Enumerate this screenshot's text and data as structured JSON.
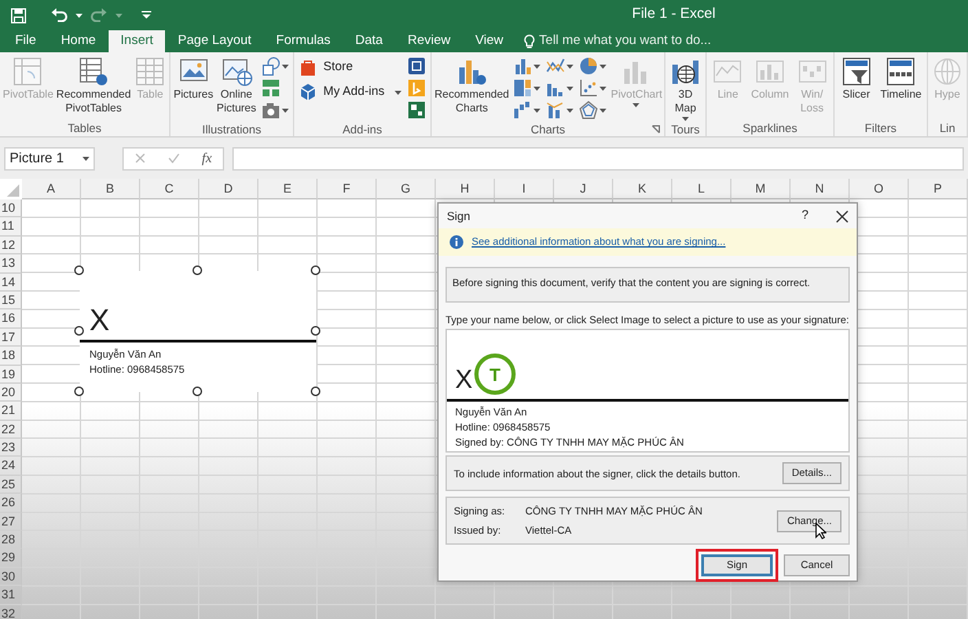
{
  "window": {
    "title": "File 1 - Excel"
  },
  "ribbon_tabs": [
    {
      "label": "File",
      "selected": false
    },
    {
      "label": "Home",
      "selected": false
    },
    {
      "label": "Insert",
      "selected": true
    },
    {
      "label": "Page Layout",
      "selected": false
    },
    {
      "label": "Formulas",
      "selected": false
    },
    {
      "label": "Data",
      "selected": false
    },
    {
      "label": "Review",
      "selected": false
    },
    {
      "label": "View",
      "selected": false
    }
  ],
  "tell_me": {
    "placeholder": "Tell me what you want to do..."
  },
  "ribbon_groups": [
    {
      "label": "Tables",
      "launcher": false,
      "items": [
        {
          "kind": "large",
          "label": "PivotTable",
          "disabled": true,
          "dropdown": false
        },
        {
          "kind": "large",
          "label": "Recommended\nPivotTables",
          "disabled": false,
          "dropdown": false
        },
        {
          "kind": "large",
          "label": "Table",
          "disabled": true,
          "dropdown": false
        }
      ]
    },
    {
      "label": "Illustrations",
      "launcher": false,
      "items": [
        {
          "kind": "large",
          "label": "Pictures",
          "disabled": false,
          "dropdown": false
        },
        {
          "kind": "large",
          "label": "Online\nPictures",
          "disabled": false,
          "dropdown": false
        },
        {
          "kind": "icon",
          "disabled": false,
          "dropdown": true
        },
        {
          "kind": "icon",
          "disabled": false,
          "dropdown": false
        },
        {
          "kind": "icon",
          "disabled": false,
          "dropdown": true
        }
      ]
    },
    {
      "label": "Add-ins",
      "launcher": false,
      "items": [
        {
          "kind": "small",
          "label": "Store",
          "disabled": false,
          "dropdown": false
        },
        {
          "kind": "small",
          "label": "My Add-ins",
          "disabled": false,
          "dropdown": true
        },
        {
          "kind": "icon",
          "disabled": false,
          "dropdown": false
        },
        {
          "kind": "icon",
          "disabled": false,
          "dropdown": false
        },
        {
          "kind": "icon",
          "disabled": false,
          "dropdown": false
        }
      ]
    },
    {
      "label": "Charts",
      "launcher": true,
      "items": [
        {
          "kind": "large",
          "label": "Recommended\nCharts",
          "disabled": false,
          "dropdown": false
        },
        {
          "kind": "icon",
          "disabled": false,
          "dropdown": true
        },
        {
          "kind": "icon",
          "disabled": false,
          "dropdown": true
        },
        {
          "kind": "icon",
          "disabled": false,
          "dropdown": true
        },
        {
          "kind": "icon",
          "disabled": false,
          "dropdown": true
        },
        {
          "kind": "icon",
          "disabled": false,
          "dropdown": true
        },
        {
          "kind": "icon",
          "disabled": false,
          "dropdown": true
        },
        {
          "kind": "icon",
          "disabled": false,
          "dropdown": true
        },
        {
          "kind": "icon",
          "disabled": false,
          "dropdown": true
        },
        {
          "kind": "icon",
          "disabled": false,
          "dropdown": true
        },
        {
          "kind": "large",
          "label": "PivotChart",
          "disabled": true,
          "dropdown": true
        }
      ]
    },
    {
      "label": "Tours",
      "launcher": false,
      "items": [
        {
          "kind": "large",
          "label": "3D\nMap",
          "disabled": false,
          "dropdown": true
        }
      ]
    },
    {
      "label": "Sparklines",
      "launcher": false,
      "items": [
        {
          "kind": "large",
          "label": "Line",
          "disabled": true,
          "dropdown": false
        },
        {
          "kind": "large",
          "label": "Column",
          "disabled": true,
          "dropdown": false
        },
        {
          "kind": "large",
          "label": "Win/\nLoss",
          "disabled": true,
          "dropdown": false
        }
      ]
    },
    {
      "label": "Filters",
      "launcher": false,
      "items": [
        {
          "kind": "large",
          "label": "Slicer",
          "disabled": false,
          "dropdown": false
        },
        {
          "kind": "large",
          "label": "Timeline",
          "disabled": false,
          "dropdown": false
        }
      ]
    },
    {
      "label": "Lin",
      "launcher": false,
      "items": [
        {
          "kind": "large",
          "label": "Hype",
          "disabled": true,
          "dropdown": false
        }
      ]
    }
  ],
  "formula_bar": {
    "name_box": "Picture 1",
    "function_label": "fx"
  },
  "sheet": {
    "columns": [
      "A",
      "B",
      "C",
      "D",
      "E",
      "F",
      "G",
      "H",
      "I",
      "J",
      "K",
      "L",
      "M",
      "N",
      "O",
      "P"
    ],
    "rows": [
      "10",
      "11",
      "12",
      "13",
      "14",
      "15",
      "16",
      "17",
      "18",
      "19",
      "20",
      "21",
      "22",
      "23",
      "24",
      "25",
      "26",
      "27",
      "28",
      "29",
      "30",
      "31",
      "32"
    ],
    "signature_object": {
      "selected": true,
      "mark": "X",
      "lines": [
        "Nguyễn Văn An",
        "Hotline: 0968458575"
      ]
    }
  },
  "dialog": {
    "title": "Sign",
    "help": "?",
    "info_link": "See additional information about what you are signing...",
    "verify_text": "Before signing this document, verify that the content you are signing is correct.",
    "prompt_text": "Type your name below, or click Select Image to select a picture to use as your signature:",
    "signature": {
      "mark": "X",
      "logo_letter": "T",
      "lines": [
        "Nguyễn Văn An",
        "Hotline: 0968458575",
        "Signed by: CÔNG TY TNHH MAY MẶC PHÚC ÂN"
      ]
    },
    "details_text": "To include information about the signer, click the details button.",
    "details_button": "Details...",
    "signing_as_label": "Signing as:",
    "signing_as": "CÔNG TY TNHH MAY MẶC PHÚC ÂN",
    "issued_by_label": "Issued by:",
    "issued_by": "Viettel-CA",
    "change_button": "Change...",
    "buttons": [
      {
        "label": "Sign",
        "highlighted": true
      },
      {
        "label": "Cancel",
        "highlighted": false
      }
    ]
  }
}
